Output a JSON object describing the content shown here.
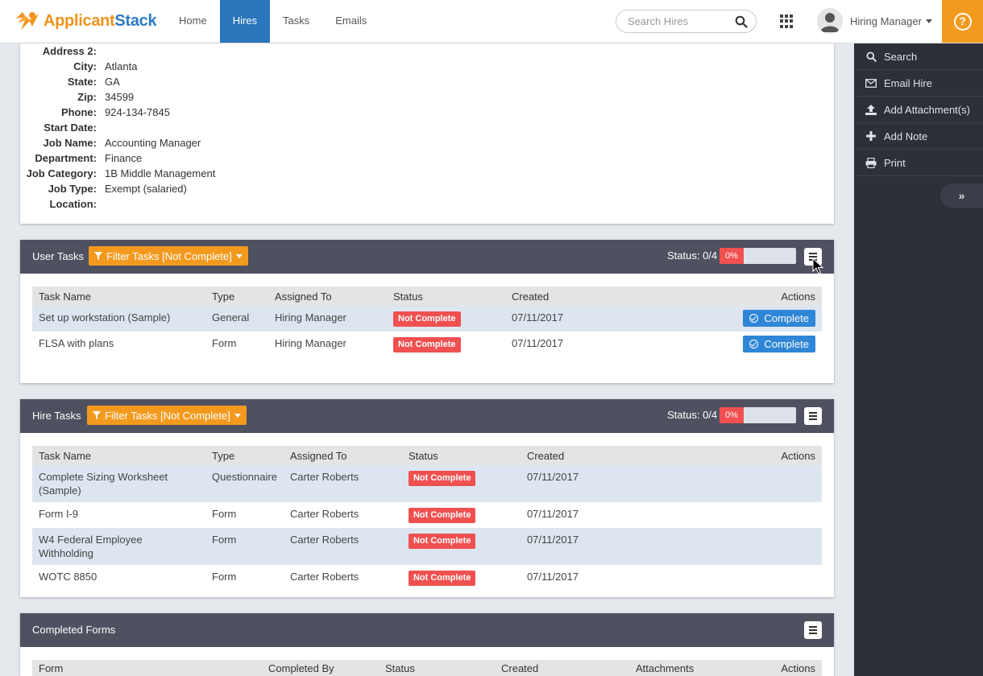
{
  "header": {
    "logo": {
      "part1": "Applicant",
      "part2": "Stack"
    },
    "nav": [
      "Home",
      "Hires",
      "Tasks",
      "Emails"
    ],
    "active_nav": "Hires",
    "search_placeholder": "Search Hires",
    "user_name": "Hiring Manager",
    "help_glyph": "?"
  },
  "sidebar": {
    "items": [
      {
        "label": "Search",
        "icon": "search-icon"
      },
      {
        "label": "Email Hire",
        "icon": "envelope-icon"
      },
      {
        "label": "Add Attachment(s)",
        "icon": "upload-icon"
      },
      {
        "label": "Add Note",
        "icon": "plus-icon"
      },
      {
        "label": "Print",
        "icon": "printer-icon"
      }
    ],
    "toggle_glyph": "»"
  },
  "details": [
    {
      "label": "Address 2:",
      "value": ""
    },
    {
      "label": "City:",
      "value": "Atlanta"
    },
    {
      "label": "State:",
      "value": "GA"
    },
    {
      "label": "Zip:",
      "value": "34599"
    },
    {
      "label": "Phone:",
      "value": "924-134-7845"
    },
    {
      "label": "Start Date:",
      "value": ""
    },
    {
      "label": "Job Name:",
      "value": "Accounting Manager"
    },
    {
      "label": "Department:",
      "value": "Finance"
    },
    {
      "label": "Job Category:",
      "value": "1B Middle Management"
    },
    {
      "label": "Job Type:",
      "value": "Exempt (salaried)"
    },
    {
      "label": "Location:",
      "value": ""
    }
  ],
  "user_tasks": {
    "title": "User Tasks",
    "filter_label": "Filter Tasks [Not Complete]",
    "status_label": "Status: 0/4",
    "progress": "0%",
    "columns": [
      "Task Name",
      "Type",
      "Assigned To",
      "Status",
      "Created",
      "Actions"
    ],
    "rows": [
      {
        "name": "Set up workstation (Sample)",
        "type": "General",
        "assigned": "Hiring Manager",
        "status": "Not Complete",
        "created": "07/11/2017",
        "action": "Complete"
      },
      {
        "name": "FLSA with plans",
        "type": "Form",
        "assigned": "Hiring Manager",
        "status": "Not Complete",
        "created": "07/11/2017",
        "action": "Complete"
      }
    ]
  },
  "hire_tasks": {
    "title": "Hire Tasks",
    "filter_label": "Filter Tasks [Not Complete]",
    "status_label": "Status: 0/4",
    "progress": "0%",
    "columns": [
      "Task Name",
      "Type",
      "Assigned To",
      "Status",
      "Created",
      "Actions"
    ],
    "rows": [
      {
        "name": "Complete Sizing Worksheet (Sample)",
        "type": "Questionnaire",
        "assigned": "Carter Roberts",
        "status": "Not Complete",
        "created": "07/11/2017"
      },
      {
        "name": "Form I-9",
        "type": "Form",
        "assigned": "Carter Roberts",
        "status": "Not Complete",
        "created": "07/11/2017"
      },
      {
        "name": "W4 Federal Employee Withholding",
        "type": "Form",
        "assigned": "Carter Roberts",
        "status": "Not Complete",
        "created": "07/11/2017"
      },
      {
        "name": "WOTC 8850",
        "type": "Form",
        "assigned": "Carter Roberts",
        "status": "Not Complete",
        "created": "07/11/2017"
      }
    ]
  },
  "completed_forms": {
    "title": "Completed Forms",
    "columns": [
      "Form",
      "Completed By",
      "Status",
      "Created",
      "Attachments",
      "Actions"
    ]
  },
  "colors": {
    "accent_orange": "#f39a1e",
    "nav_active_blue": "#2a75bb",
    "card_header": "#4f5160",
    "sidebar_bg": "#2d2f39",
    "badge_red": "#f05050",
    "button_blue": "#2f86d6"
  }
}
